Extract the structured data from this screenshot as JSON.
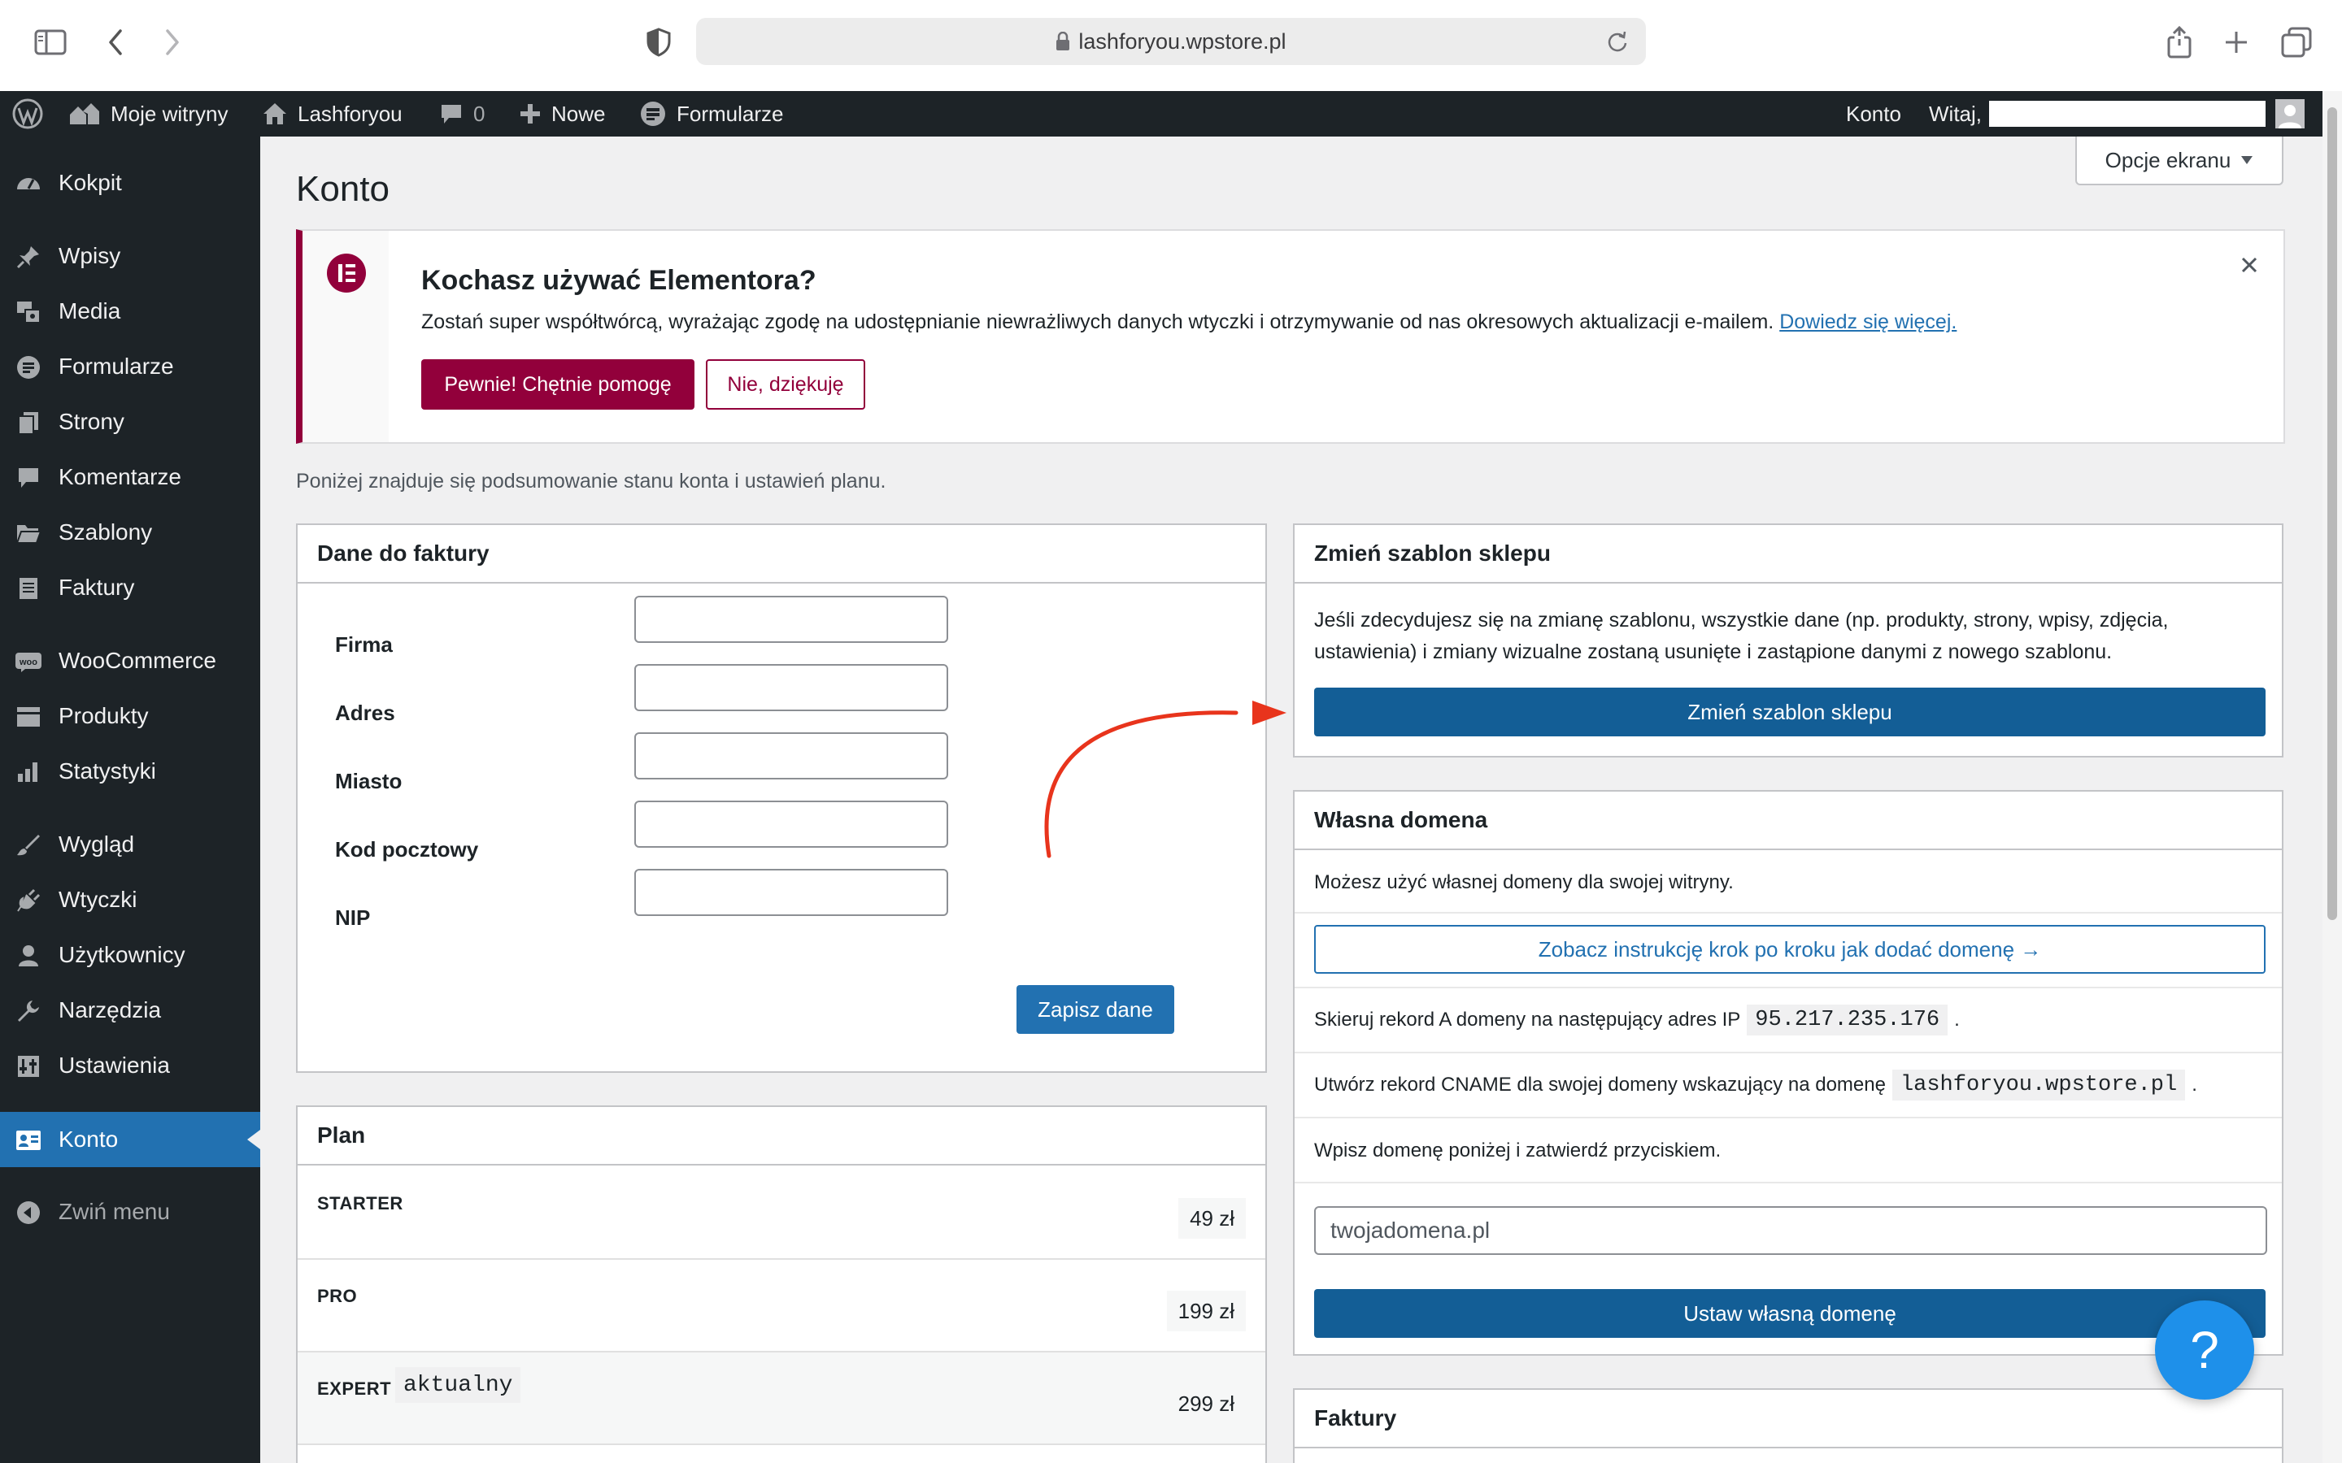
{
  "browser": {
    "url": "lashforyou.wpstore.pl"
  },
  "admin_bar": {
    "my_sites": "Moje witryny",
    "site_name": "Lashforyou",
    "comments_count": "0",
    "new_label": "Nowe",
    "forms_label": "Formularze",
    "account_label": "Konto",
    "greeting": "Witaj,"
  },
  "sidebar": {
    "items": [
      {
        "label": "Kokpit",
        "icon": "dashboard-icon"
      },
      {
        "label": "Wpisy",
        "icon": "pin-icon"
      },
      {
        "label": "Media",
        "icon": "media-icon"
      },
      {
        "label": "Formularze",
        "icon": "forms-icon"
      },
      {
        "label": "Strony",
        "icon": "pages-icon"
      },
      {
        "label": "Komentarze",
        "icon": "comments-icon"
      },
      {
        "label": "Szablony",
        "icon": "folder-icon"
      },
      {
        "label": "Faktury",
        "icon": "invoice-icon"
      },
      {
        "label": "WooCommerce",
        "icon": "woo-icon"
      },
      {
        "label": "Produkty",
        "icon": "products-icon"
      },
      {
        "label": "Statystyki",
        "icon": "stats-icon"
      },
      {
        "label": "Wygląd",
        "icon": "brush-icon"
      },
      {
        "label": "Wtyczki",
        "icon": "plugin-icon"
      },
      {
        "label": "Użytkownicy",
        "icon": "user-icon"
      },
      {
        "label": "Narzędzia",
        "icon": "wrench-icon"
      },
      {
        "label": "Ustawienia",
        "icon": "settings-icon"
      },
      {
        "label": "Konto",
        "icon": "account-icon",
        "active": true
      }
    ],
    "collapse_label": "Zwiń menu"
  },
  "screen_options": "Opcje ekranu",
  "page_title": "Konto",
  "notice": {
    "title": "Kochasz używać Elementora?",
    "text": "Zostań super współtwórcą, wyrażając zgodę na udostępnianie niewrażliwych danych wtyczki i otrzymywanie od nas okresowych aktualizacji e-mailem.",
    "link": "Dowiedz się więcej.",
    "yes_button": "Pewnie! Chętnie pomogę",
    "no_button": "Nie, dziękuję"
  },
  "summary": "Poniżej znajduje się podsumowanie stanu konta i ustawień planu.",
  "billing": {
    "title": "Dane do faktury",
    "fields": [
      {
        "label": "Firma",
        "value": ""
      },
      {
        "label": "Adres",
        "value": ""
      },
      {
        "label": "Miasto",
        "value": ""
      },
      {
        "label": "Kod pocztowy",
        "value": ""
      },
      {
        "label": "NIP",
        "value": ""
      }
    ],
    "save_button": "Zapisz dane"
  },
  "plan": {
    "title": "Plan",
    "rows": [
      {
        "name": "STARTER",
        "price": "49 zł",
        "badge": ""
      },
      {
        "name": "PRO",
        "price": "199 zł",
        "badge": ""
      },
      {
        "name": "EXPERT",
        "price": "299 zł",
        "badge": "aktualny"
      }
    ]
  },
  "template": {
    "title": "Zmień szablon sklepu",
    "text": "Jeśli zdecydujesz się na zmianę szablonu, wszystkie dane (np. produkty, strony, wpisy, zdjęcia, ustawienia) i zmiany wizualne zostaną usunięte i zastąpione danymi z nowego szablonu.",
    "button": "Zmień szablon sklepu"
  },
  "domain": {
    "title": "Własna domena",
    "intro": "Możesz użyć własnej domeny dla swojej witryny.",
    "guide_button": "Zobacz instrukcję krok po kroku jak dodać domenę →",
    "a_record_text": "Skieruj rekord A domeny na następujący adres IP",
    "ip": "95.217.235.176",
    "cname_text": "Utwórz rekord CNAME dla swojej domeny wskazujący na domenę",
    "cname_target": "lashforyou.wpstore.pl",
    "period": ".",
    "enter_text": "Wpisz domenę poniżej i zatwierdź przyciskiem.",
    "input_placeholder": "twojadomena.pl",
    "set_button": "Ustaw własną domenę"
  },
  "invoices": {
    "title": "Faktury"
  },
  "help_label": "?",
  "colors": {
    "accent": "#2271b1",
    "elementor": "#92003b",
    "admin_dark": "#1d2327",
    "annotation_arrow": "#e8341c"
  }
}
